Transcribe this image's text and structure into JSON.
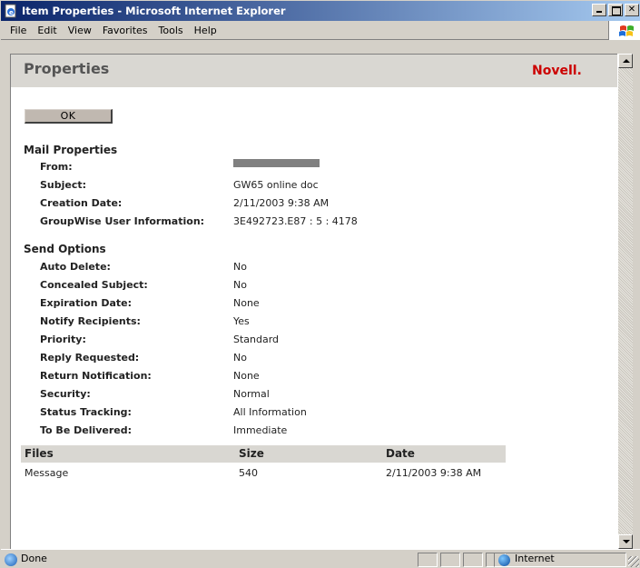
{
  "window": {
    "title": "Item Properties - Microsoft Internet Explorer"
  },
  "menu": {
    "items": [
      {
        "label": "File",
        "accel": "F"
      },
      {
        "label": "Edit",
        "accel": "E"
      },
      {
        "label": "View",
        "accel": "V"
      },
      {
        "label": "Favorites",
        "accel": "a"
      },
      {
        "label": "Tools",
        "accel": "T"
      },
      {
        "label": "Help",
        "accel": "H"
      }
    ]
  },
  "page": {
    "title": "Properties",
    "brand": "Novell.",
    "brand_color": "#cc0000",
    "ok_label": "OK"
  },
  "mail_properties": {
    "heading": "Mail Properties",
    "rows": [
      {
        "label": "From:",
        "value": ""
      },
      {
        "label": "Subject:",
        "value": "GW65 online doc"
      },
      {
        "label": "Creation Date:",
        "value": "2/11/2003 9:38 AM"
      },
      {
        "label": "GroupWise User Information:",
        "value": "3E492723.E87 : 5 : 4178"
      }
    ]
  },
  "send_options": {
    "heading": "Send Options",
    "rows": [
      {
        "label": "Auto Delete:",
        "value": "No"
      },
      {
        "label": "Concealed Subject:",
        "value": "No"
      },
      {
        "label": "Expiration Date:",
        "value": "None"
      },
      {
        "label": "Notify Recipients:",
        "value": "Yes"
      },
      {
        "label": "Priority:",
        "value": "Standard"
      },
      {
        "label": "Reply Requested:",
        "value": "No"
      },
      {
        "label": "Return Notification:",
        "value": "None"
      },
      {
        "label": "Security:",
        "value": "Normal"
      },
      {
        "label": "Status Tracking:",
        "value": "All Information"
      },
      {
        "label": "To Be Delivered:",
        "value": "Immediate"
      }
    ]
  },
  "files": {
    "columns": [
      "Files",
      "Size",
      "Date"
    ],
    "rows": [
      [
        "Message",
        "540",
        "2/11/2003 9:38 AM"
      ]
    ]
  },
  "status": {
    "left": "Done",
    "zone": "Internet"
  }
}
